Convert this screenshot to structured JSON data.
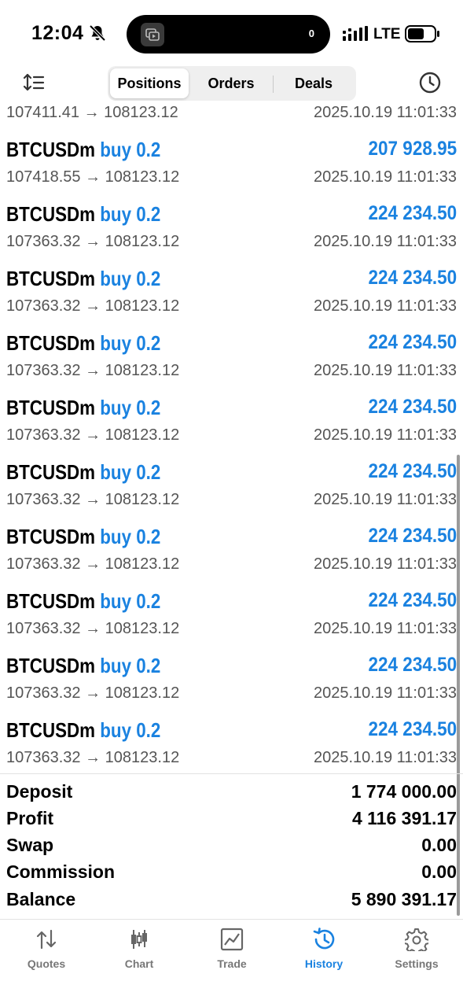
{
  "status_bar": {
    "time": "12:04",
    "island_count": "0",
    "network": "LTE",
    "icons": [
      "bell-slash-icon",
      "screen-mirror-icon",
      "signal-icon",
      "battery-icon"
    ]
  },
  "toolbar": {
    "tabs": [
      {
        "label": "Positions",
        "active": true
      },
      {
        "label": "Orders",
        "active": false
      },
      {
        "label": "Deals",
        "active": false
      }
    ],
    "left_icon": "sort-icon",
    "right_icon": "clock-icon"
  },
  "deals": [
    {
      "symbol": "",
      "direction": "",
      "profit": "",
      "prices": "107411.41 → 108123.12",
      "time": "2025.10.19 11:01:33"
    },
    {
      "symbol": "BTCUSDm",
      "direction": "buy 0.2",
      "profit": "207 928.95",
      "prices": "107418.55 → 108123.12",
      "time": "2025.10.19 11:01:33"
    },
    {
      "symbol": "BTCUSDm",
      "direction": "buy 0.2",
      "profit": "224 234.50",
      "prices": "107363.32 → 108123.12",
      "time": "2025.10.19 11:01:33"
    },
    {
      "symbol": "BTCUSDm",
      "direction": "buy 0.2",
      "profit": "224 234.50",
      "prices": "107363.32 → 108123.12",
      "time": "2025.10.19 11:01:33"
    },
    {
      "symbol": "BTCUSDm",
      "direction": "buy 0.2",
      "profit": "224 234.50",
      "prices": "107363.32 → 108123.12",
      "time": "2025.10.19 11:01:33"
    },
    {
      "symbol": "BTCUSDm",
      "direction": "buy 0.2",
      "profit": "224 234.50",
      "prices": "107363.32 → 108123.12",
      "time": "2025.10.19 11:01:33"
    },
    {
      "symbol": "BTCUSDm",
      "direction": "buy 0.2",
      "profit": "224 234.50",
      "prices": "107363.32 → 108123.12",
      "time": "2025.10.19 11:01:33"
    },
    {
      "symbol": "BTCUSDm",
      "direction": "buy 0.2",
      "profit": "224 234.50",
      "prices": "107363.32 → 108123.12",
      "time": "2025.10.19 11:01:33"
    },
    {
      "symbol": "BTCUSDm",
      "direction": "buy 0.2",
      "profit": "224 234.50",
      "prices": "107363.32 → 108123.12",
      "time": "2025.10.19 11:01:33"
    },
    {
      "symbol": "BTCUSDm",
      "direction": "buy 0.2",
      "profit": "224 234.50",
      "prices": "107363.32 → 108123.12",
      "time": "2025.10.19 11:01:33"
    },
    {
      "symbol": "BTCUSDm",
      "direction": "buy 0.2",
      "profit": "224 234.50",
      "prices": "107363.32 → 108123.12",
      "time": "2025.10.19 11:01:33"
    }
  ],
  "summary": [
    {
      "label": "Deposit",
      "value": "1 774 000.00"
    },
    {
      "label": "Profit",
      "value": "4 116 391.17"
    },
    {
      "label": "Swap",
      "value": "0.00"
    },
    {
      "label": "Commission",
      "value": "0.00"
    },
    {
      "label": "Balance",
      "value": "5 890 391.17"
    }
  ],
  "nav": [
    {
      "label": "Quotes",
      "icon": "quotes-icon",
      "active": false
    },
    {
      "label": "Chart",
      "icon": "chart-icon",
      "active": false
    },
    {
      "label": "Trade",
      "icon": "trade-icon",
      "active": false
    },
    {
      "label": "History",
      "icon": "history-icon",
      "active": true
    },
    {
      "label": "Settings",
      "icon": "settings-icon",
      "active": false
    }
  ],
  "colors": {
    "accent": "#1a82e0",
    "secondary_text": "#555555",
    "inactive_nav": "#777777"
  }
}
